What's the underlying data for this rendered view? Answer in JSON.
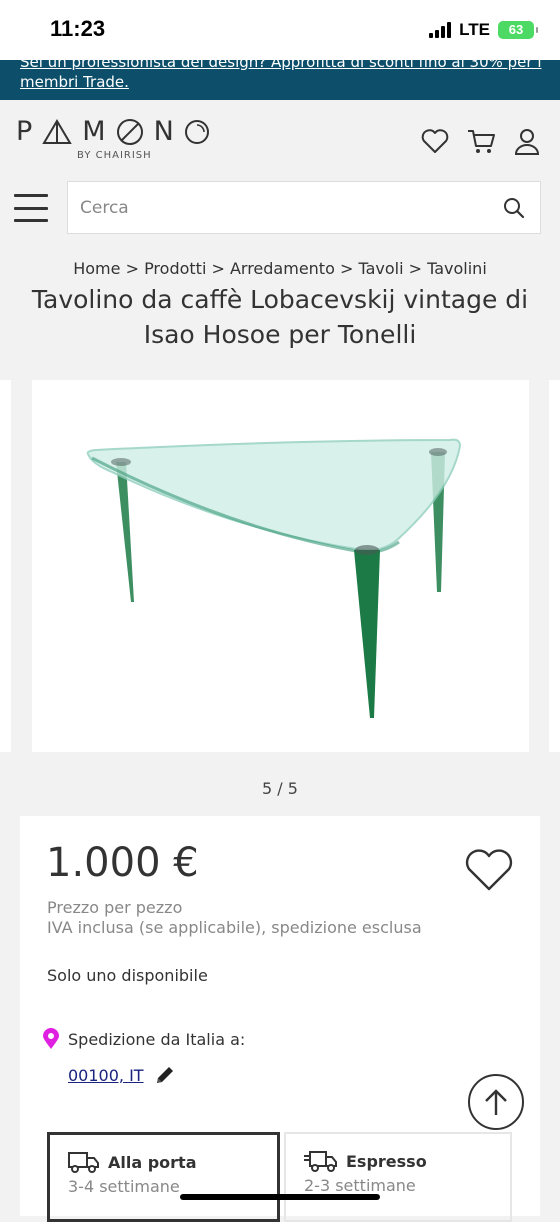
{
  "status": {
    "time": "11:23",
    "network": "LTE",
    "battery": "63"
  },
  "promo": {
    "text": "Sei un professionista del design? Approfitta di sconti fino al 30% per i membri Trade."
  },
  "logo": {
    "letters": [
      "P",
      "A",
      "M",
      "O",
      "N",
      "O"
    ],
    "subtitle": "BY CHAIRISH"
  },
  "header_icons": [
    "heart-icon",
    "cart-icon",
    "user-icon"
  ],
  "search": {
    "placeholder": "Cerca"
  },
  "breadcrumb": {
    "text": "Home > Prodotti > Arredamento > Tavoli > Tavolini"
  },
  "product": {
    "title": "Tavolino da caffè Lobacevskij vintage di Isao Hosoe per Tonelli",
    "image_counter": "5 / 5",
    "price": "1.000 €",
    "price_unit": "Prezzo per pezzo",
    "vat_note": "IVA inclusa (se applicabile), spedizione esclusa",
    "availability": "Solo uno disponibile"
  },
  "shipping": {
    "from_label": "Spedizione da Italia a:",
    "zip": "00100, IT",
    "options": [
      {
        "label": "Alla porta",
        "time": "3-4 settimane"
      },
      {
        "label": "Espresso",
        "time": "2-3 settimane"
      }
    ]
  },
  "colors": {
    "promo_bg": "#0d4f6b",
    "accent_pin": "#e020e0",
    "battery": "#4cd964",
    "glass_leg": "#1b7a45"
  }
}
